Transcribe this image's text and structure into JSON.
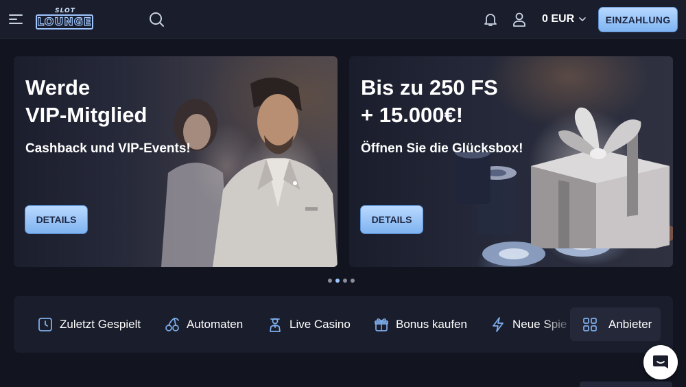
{
  "header": {
    "logo_top": "SLOT",
    "logo_main": "LOUNGE",
    "balance": "0 EUR",
    "deposit_label": "EINZAHLUNG"
  },
  "banners": [
    {
      "title": "Werde\nVIP-Mitglied",
      "subtitle": "Cashback und VIP-Events!",
      "button": "DETAILS"
    },
    {
      "title": "Bis zu 250 FS\n+ 15.000€!",
      "subtitle": "Öffnen Sie die Glücksbox!",
      "button": "DETAILS"
    }
  ],
  "carousel": {
    "count": 4,
    "active_index": 1
  },
  "categories": [
    {
      "label": "Zuletzt Gespielt",
      "icon": "clock-icon"
    },
    {
      "label": "Automaten",
      "icon": "cherries-icon"
    },
    {
      "label": "Live Casino",
      "icon": "dealer-icon"
    },
    {
      "label": "Bonus kaufen",
      "icon": "gift-icon"
    },
    {
      "label": "Neue Spie",
      "icon": "lightning-icon"
    }
  ],
  "provider": {
    "label": "Anbieter",
    "icon": "grid-icon"
  },
  "colors": {
    "background": "#121420",
    "header": "#1a1d2b",
    "accent": "#9ec7ff",
    "icon_blue": "#7fb0ee"
  },
  "icons": {
    "menu": "menu-icon",
    "search": "search-icon",
    "bell": "bell-icon",
    "user": "user-icon",
    "chevron": "chevron-down-icon",
    "chat": "chat-icon"
  }
}
